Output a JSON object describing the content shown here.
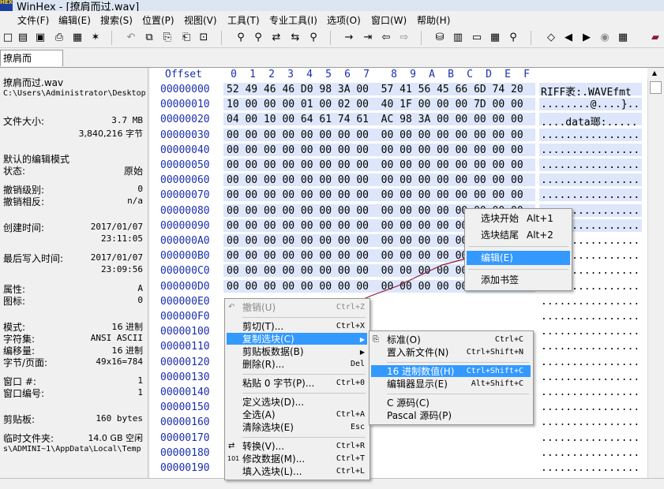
{
  "window": {
    "title": "WinHex - [撩肩而过.wav]",
    "logo_text": "HEX"
  },
  "menu": [
    {
      "label": "文件(F)"
    },
    {
      "label": "编辑(E)"
    },
    {
      "label": "搜索(S)"
    },
    {
      "label": "位置(P)"
    },
    {
      "label": "视图(V)"
    },
    {
      "label": "工具(T)"
    },
    {
      "label": "专业工具(I)"
    },
    {
      "label": "选项(O)"
    },
    {
      "label": "窗口(W)"
    },
    {
      "label": "帮助(H)"
    }
  ],
  "toolbar_icons": [
    {
      "icon": "new-file-icon",
      "glyph": "□"
    },
    {
      "icon": "open-folder-icon",
      "glyph": "▤"
    },
    {
      "icon": "save-icon",
      "glyph": "▣"
    },
    {
      "icon": "print-icon",
      "glyph": "⎙"
    },
    {
      "icon": "properties-icon",
      "glyph": "▦"
    },
    {
      "icon": "open-folder-star-icon",
      "glyph": "✶"
    },
    {
      "icon": "undo-icon",
      "glyph": "↶"
    },
    {
      "icon": "copy-block-icon",
      "glyph": "⧉"
    },
    {
      "icon": "copy-icon",
      "glyph": "⎘"
    },
    {
      "icon": "paste-icon",
      "glyph": "⎗"
    },
    {
      "icon": "binary-icon",
      "glyph": "⊡"
    },
    {
      "icon": "find-icon",
      "glyph": "⚲"
    },
    {
      "icon": "find-hex-icon",
      "glyph": "⚲"
    },
    {
      "icon": "replace-text-icon",
      "glyph": "⇄"
    },
    {
      "icon": "replace-hex-icon",
      "glyph": "⇆"
    },
    {
      "icon": "find-next-icon",
      "glyph": "⚲"
    },
    {
      "icon": "goto-arrow-icon",
      "glyph": "→"
    },
    {
      "icon": "goto-offset-icon",
      "glyph": "⇥"
    },
    {
      "icon": "back-icon",
      "glyph": "⇦"
    },
    {
      "icon": "forward-icon",
      "glyph": "⇨"
    },
    {
      "icon": "disk-icon",
      "glyph": "⛁"
    },
    {
      "icon": "ram-icon",
      "glyph": "▥"
    },
    {
      "icon": "drive-icon",
      "glyph": "▭"
    },
    {
      "icon": "calculator-icon",
      "glyph": "▦"
    },
    {
      "icon": "search-icon",
      "glyph": "⚲"
    },
    {
      "icon": "bookmark-icon",
      "glyph": "◇"
    },
    {
      "icon": "previous-icon",
      "glyph": "◀"
    },
    {
      "icon": "next-icon",
      "glyph": "▶"
    },
    {
      "icon": "camera-icon",
      "glyph": "◉"
    },
    {
      "icon": "grid-icon",
      "glyph": "▦"
    },
    {
      "icon": "book-icon",
      "glyph": "▰"
    }
  ],
  "tab": {
    "label": "撩肩而过.wav"
  },
  "info": {
    "filename": "撩肩而过.wav",
    "path": "C:\\Users\\Administrator\\Desktop",
    "size_label": "文件大小:",
    "size_mb": "3.7 MB",
    "size_bytes": "3,840,216 字节",
    "edit_mode_label": "默认的编辑模式",
    "state_label": "状态:",
    "state_value": "原始",
    "undo_level_label": "撤销级别:",
    "undo_level_value": "0",
    "undo_reverse_label": "撤销相反:",
    "undo_reverse_value": "n/a",
    "created_label": "创建时间:",
    "created_date": "2017/01/07",
    "created_time": "23:11:05",
    "written_label": "最后写入时间:",
    "written_date": "2017/01/07",
    "written_time": "23:09:56",
    "attr_label": "属性:",
    "attr_value": "A",
    "icon_label": "图标:",
    "icon_value": "0",
    "mode_label": "模式:",
    "mode_value": "16 进制",
    "charset_label": "字符集:",
    "charset_value": "ANSI ASCII",
    "offset_label": "编移量:",
    "offset_value": "16 进制",
    "bpp_label": "字节/页面:",
    "bpp_value": "49x16=784",
    "window_no_label": "窗口 #:",
    "window_no_value": "1",
    "window_id_label": "窗口编号:",
    "window_id_value": "1",
    "clipboard_label": "剪贴板:",
    "clipboard_value": "160 bytes",
    "temp_label": "临时文件夹:",
    "temp_value": "14.0 GB 空闲",
    "temp_path": "s\\ADMINI~1\\AppData\\Local\\Temp"
  },
  "hex": {
    "offset_header": "Offset",
    "columns": [
      "0",
      "1",
      "2",
      "3",
      "4",
      "5",
      "6",
      "7",
      "8",
      "9",
      "A",
      "B",
      "C",
      "D",
      "E",
      "F"
    ],
    "rows": [
      {
        "off": "00000000",
        "hex": "52 49 46 46 D0 98 3A 00  57 41 56 45 66 6D 74 20",
        "ascii": "RIFF袤:.WAVEfmt"
      },
      {
        "off": "00000010",
        "hex": "10 00 00 00 01 00 02 00  40 1F 00 00 00 7D 00 00",
        "ascii": "........@....}.."
      },
      {
        "off": "00000020",
        "hex": "04 00 10 00 64 61 74 61  AC 98 3A 00 00 00 00 00",
        "ascii": "....data瑯:....."
      },
      {
        "off": "00000030",
        "hex": "00 00 00 00 00 00 00 00  00 00 00 00 00 00 00 00",
        "ascii": "................"
      },
      {
        "off": "00000040",
        "hex": "00 00 00 00 00 00 00 00  00 00 00 00 00 00 00 00",
        "ascii": "................"
      },
      {
        "off": "00000050",
        "hex": "00 00 00 00 00 00 00 00  00 00 00 00 00 00 00 00",
        "ascii": "................"
      },
      {
        "off": "00000060",
        "hex": "00 00 00 00 00 00 00 00  00 00 00 00 00 00 00 00",
        "ascii": "................"
      },
      {
        "off": "00000070",
        "hex": "00 00 00 00 00 00 00 00  00 00 00 00 00 00 00 00",
        "ascii": "................"
      },
      {
        "off": "00000080",
        "hex": "00 00 00 00 00 00 00 00  00 00 00 00 00 00 00 00",
        "ascii": "................"
      },
      {
        "off": "00000090",
        "hex": "00 00 00 00 00 00 00 00  00 00 00 00 00 00 00 00",
        "ascii": "................"
      },
      {
        "off": "000000A0",
        "hex": "00 00 00 00 00 00 00 00  00 00 00 00 00 00 00 00",
        "ascii": "................"
      },
      {
        "off": "000000B0",
        "hex": "00 00 00 00 00 00 00 00  00 00 00 00 00 00 00 00",
        "ascii": "................"
      },
      {
        "off": "000000C0",
        "hex": "00 00 00 00 00 00 00 00  00 00 00 00 00 00 00 00",
        "ascii": "................"
      },
      {
        "off": "000000D0",
        "hex": "00 00 00 00 00 00 00 00  00 00 00 00 00 00 00 00",
        "ascii": "................"
      },
      {
        "off": "000000E0",
        "hex": "",
        "ascii": "................"
      },
      {
        "off": "000000F0",
        "hex": "",
        "ascii": "................"
      },
      {
        "off": "00000100",
        "hex": "",
        "ascii": "................"
      },
      {
        "off": "00000110",
        "hex": "",
        "ascii": "................"
      },
      {
        "off": "00000120",
        "hex": "",
        "ascii": "................"
      },
      {
        "off": "00000130",
        "hex": "",
        "ascii": "................"
      },
      {
        "off": "00000140",
        "hex": "",
        "ascii": "................"
      },
      {
        "off": "00000150",
        "hex": "",
        "ascii": "................"
      },
      {
        "off": "00000160",
        "hex": "",
        "ascii": "................"
      },
      {
        "off": "00000170",
        "hex": "",
        "ascii": "................"
      },
      {
        "off": "00000180",
        "hex": "",
        "ascii": "................"
      },
      {
        "off": "00000190",
        "hex": "",
        "ascii": "................"
      }
    ]
  },
  "context_menu": {
    "items": [
      {
        "label": "撤销(U)",
        "shortcut": "Ctrl+Z",
        "disabled": true
      },
      {
        "label": "剪切(T)...",
        "shortcut": "Ctrl+X"
      },
      {
        "label": "复制选块(C)",
        "shortcut": "",
        "submenu": true,
        "selected": true
      },
      {
        "label": "剪贴板数据(B)",
        "shortcut": "",
        "submenu": true
      },
      {
        "label": "删除(R)...",
        "shortcut": "Del"
      },
      {
        "label": "粘贴 0 字节(P)...",
        "shortcut": "Ctrl+0"
      },
      {
        "label": "定义选块(D)...",
        "shortcut": ""
      },
      {
        "label": "全选(A)",
        "shortcut": "Ctrl+A"
      },
      {
        "label": "清除选块(E)",
        "shortcut": "Esc"
      },
      {
        "label": "转换(V)...",
        "shortcut": "Ctrl+R"
      },
      {
        "label": "修改数据(M)...",
        "shortcut": "Ctrl+T"
      },
      {
        "label": "填入选块(L)...",
        "shortcut": "Ctrl+L"
      }
    ]
  },
  "copy_submenu": {
    "items": [
      {
        "label": "标准(O)",
        "shortcut": "Ctrl+C"
      },
      {
        "label": "置入新文件(N)",
        "shortcut": "Ctrl+Shift+N"
      },
      {
        "label": "16 进制数值(H)",
        "shortcut": "Ctrl+Shift+C",
        "selected": true
      },
      {
        "label": "编辑器显示(E)",
        "shortcut": "Alt+Shift+C"
      },
      {
        "label": "C 源码(C)",
        "shortcut": ""
      },
      {
        "label": "Pascal 源码(P)",
        "shortcut": ""
      }
    ]
  },
  "block_menu": {
    "items": [
      {
        "label": "选块开始",
        "shortcut": "Alt+1"
      },
      {
        "label": "选块结尾",
        "shortcut": "Alt+2"
      },
      {
        "label": "编辑(E)",
        "shortcut": "",
        "selected": true
      },
      {
        "label": "添加书签",
        "shortcut": ""
      }
    ]
  },
  "colors": {
    "accent": "#3399ff",
    "offset_blue": "#1a2fb0",
    "row_highlight": "#dde6fa",
    "annotation_line": "#8b1a3a"
  }
}
